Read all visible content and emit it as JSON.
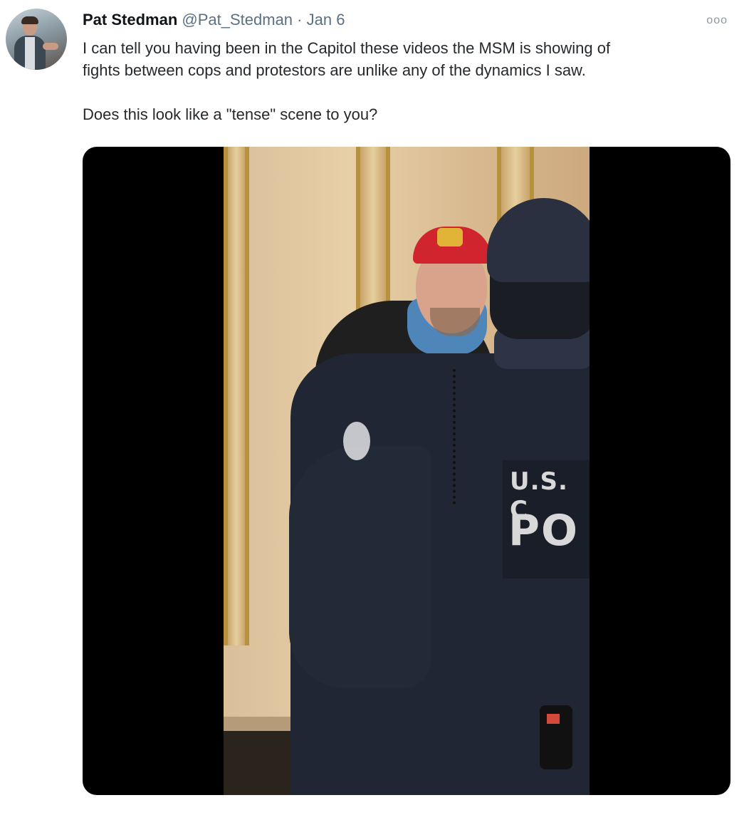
{
  "tweet": {
    "author_name": "Pat Stedman",
    "author_handle": "@Pat_Stedman",
    "separator": "·",
    "date": "Jan 6",
    "more_icon": "ooo",
    "text": "I can tell you having been in the Capitol these videos the MSM is showing of\nfights between cops and protestors are unlike any of the dynamics I saw.\n\nDoes this look like a \"tense\" scene to you?"
  },
  "media": {
    "patch_line1": "U.S. C",
    "patch_line2": "PO"
  },
  "colors": {
    "name": "#0f1419",
    "secondary": "#5b7083",
    "media_background": "#000000"
  }
}
